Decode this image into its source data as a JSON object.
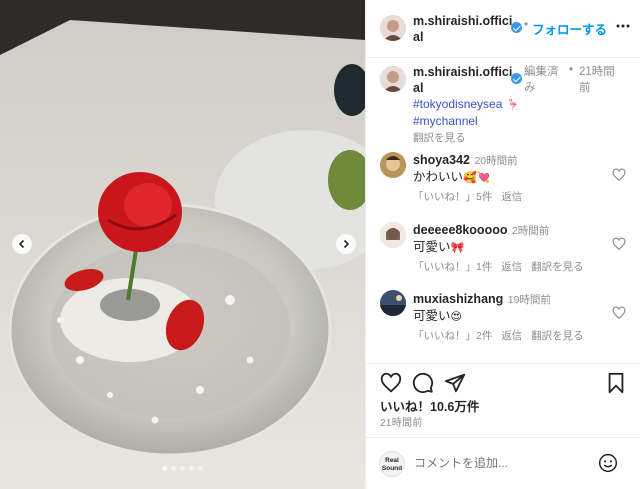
{
  "post": {
    "author": "m.shiraishi.official",
    "author_line1": "m.shiraishi.offici",
    "author_line2": "al",
    "follow_label": "フォローする",
    "separator": "•"
  },
  "caption": {
    "author_line1": "m.shiraishi.offici",
    "author_line2": "al",
    "edited_line1": "編集済",
    "edited_line2": "み",
    "time_line1": "21時間",
    "time_line2": "前",
    "hashtag1": "#tokyodisneysea",
    "hashtag2": "#mychannel",
    "translate": "翻訳を見る"
  },
  "comments": [
    {
      "user": "shoya342",
      "time": "20時間前",
      "text": "かわいい",
      "likes": "「いいね！」5件",
      "reply": "返信",
      "translate": ""
    },
    {
      "user": "deeeee8kooooo",
      "time": "2時間前",
      "text": "可愛い",
      "likes": "「いいね！」1件",
      "reply": "返信",
      "translate": "翻訳を見る"
    },
    {
      "user": "muxiashizhang",
      "time": "19時間前",
      "text": "可愛い",
      "likes": "「いいね！」2件",
      "reply": "返信",
      "translate": "翻訳を見る"
    }
  ],
  "stats": {
    "likes": "いいね！10.6万件",
    "posted": "21時間前"
  },
  "composer": {
    "placeholder": "コメントを追加...",
    "badge_line1": "Real",
    "badge_line2": "Sound"
  },
  "carousel": {
    "slides": 5,
    "active": 0
  },
  "colors": {
    "accent": "#0095f6",
    "hashtag": "#3950c6",
    "muted": "#8e8e8e"
  },
  "icons": [
    "chevron-left-icon",
    "chevron-right-icon",
    "verified-icon",
    "more-icon",
    "heart-icon",
    "comment-icon",
    "share-icon",
    "bookmark-icon",
    "emoji-icon"
  ]
}
